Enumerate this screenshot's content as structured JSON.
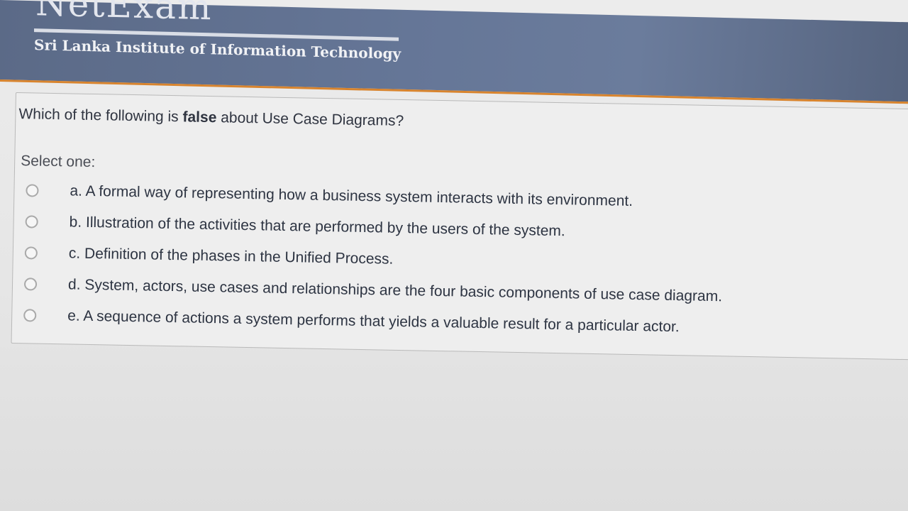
{
  "header": {
    "logo_text": "NetExam",
    "subtitle": "Sri Lanka Institute of Information Technology",
    "accent_color": "#d8842e",
    "banner_color": "#65769a"
  },
  "question": {
    "prefix": "Which of the following is ",
    "emphasis": "false",
    "suffix": " about Use Case Diagrams?",
    "select_prompt": "Select one:",
    "options": [
      {
        "label": "a. A formal way of representing how a business system interacts with its environment.",
        "selected": false
      },
      {
        "label": "b. Illustration of the activities that are performed by the users of the system.",
        "selected": false
      },
      {
        "label": "c. Definition of the phases in the Unified Process.",
        "selected": false
      },
      {
        "label": "d. System, actors, use cases and relationships are the four basic components of use case diagram.",
        "selected": false
      },
      {
        "label": "e. A sequence of actions a system performs that yields a valuable result for a particular actor.",
        "selected": false
      }
    ]
  }
}
